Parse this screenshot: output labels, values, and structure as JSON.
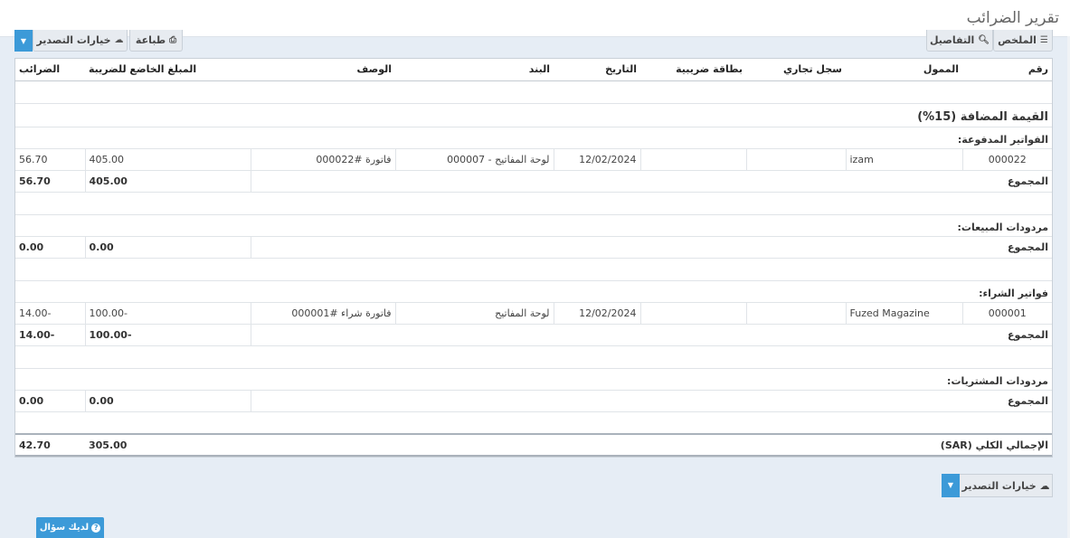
{
  "page": {
    "title": "تقرير الضرائب"
  },
  "toolbar": {
    "summary_label": "الملخص",
    "details_label": "التفاصيل",
    "print_label": "طباعة",
    "export_label": "خيارات التصدير"
  },
  "table": {
    "headers": [
      "رقم",
      "الممول",
      "سجل تجاري",
      "بطاقة ضريبية",
      "التاريخ",
      "البند",
      "الوصف",
      "المبلغ الخاضع للضريبة",
      "الضرائب"
    ],
    "vat_heading": "القيمة المضافة (15%)",
    "total_label": "المجموع",
    "sections": [
      {
        "title": "الفواتير المدفوعة:",
        "rows": [
          {
            "id": "000022",
            "payer": "izam",
            "cr": "",
            "tax_card": "",
            "date": "12/02/2024",
            "item": "لوحة المفاتيح - 000007",
            "desc": "فاتورة #000022",
            "taxable": "405.00",
            "tax": "56.70"
          }
        ],
        "total_taxable": "405.00",
        "total_tax": "56.70"
      },
      {
        "title": "مردودات المبيعات:",
        "rows": [],
        "total_taxable": "0.00",
        "total_tax": "0.00"
      },
      {
        "title": "فواتير الشراء:",
        "rows": [
          {
            "id": "000001",
            "payer": "Fuzed Magazine",
            "cr": "",
            "tax_card": "",
            "date": "12/02/2024",
            "item": "لوحة المفاتيح",
            "desc": "فاتورة شراء #000001",
            "taxable": "-100.00",
            "tax": "-14.00"
          }
        ],
        "total_taxable": "-100.00",
        "total_tax": "-14.00"
      },
      {
        "title": "مردودات المشتريات:",
        "rows": [],
        "total_taxable": "0.00",
        "total_tax": "0.00"
      }
    ],
    "grand_total_label": "الإجمالي الكلي (SAR)",
    "grand_total_taxable": "305.00",
    "grand_total_tax": "42.70"
  },
  "footer": {
    "export_label": "خيارات التصدير",
    "help_label": "لديك سؤال"
  },
  "colors": {
    "accent": "#3c9ad8",
    "background": "#e6edf5"
  },
  "icons": {
    "summary": "list-icon",
    "details": "search-icon",
    "print": "print-icon",
    "export": "cloud-download-icon",
    "help": "question-icon"
  }
}
